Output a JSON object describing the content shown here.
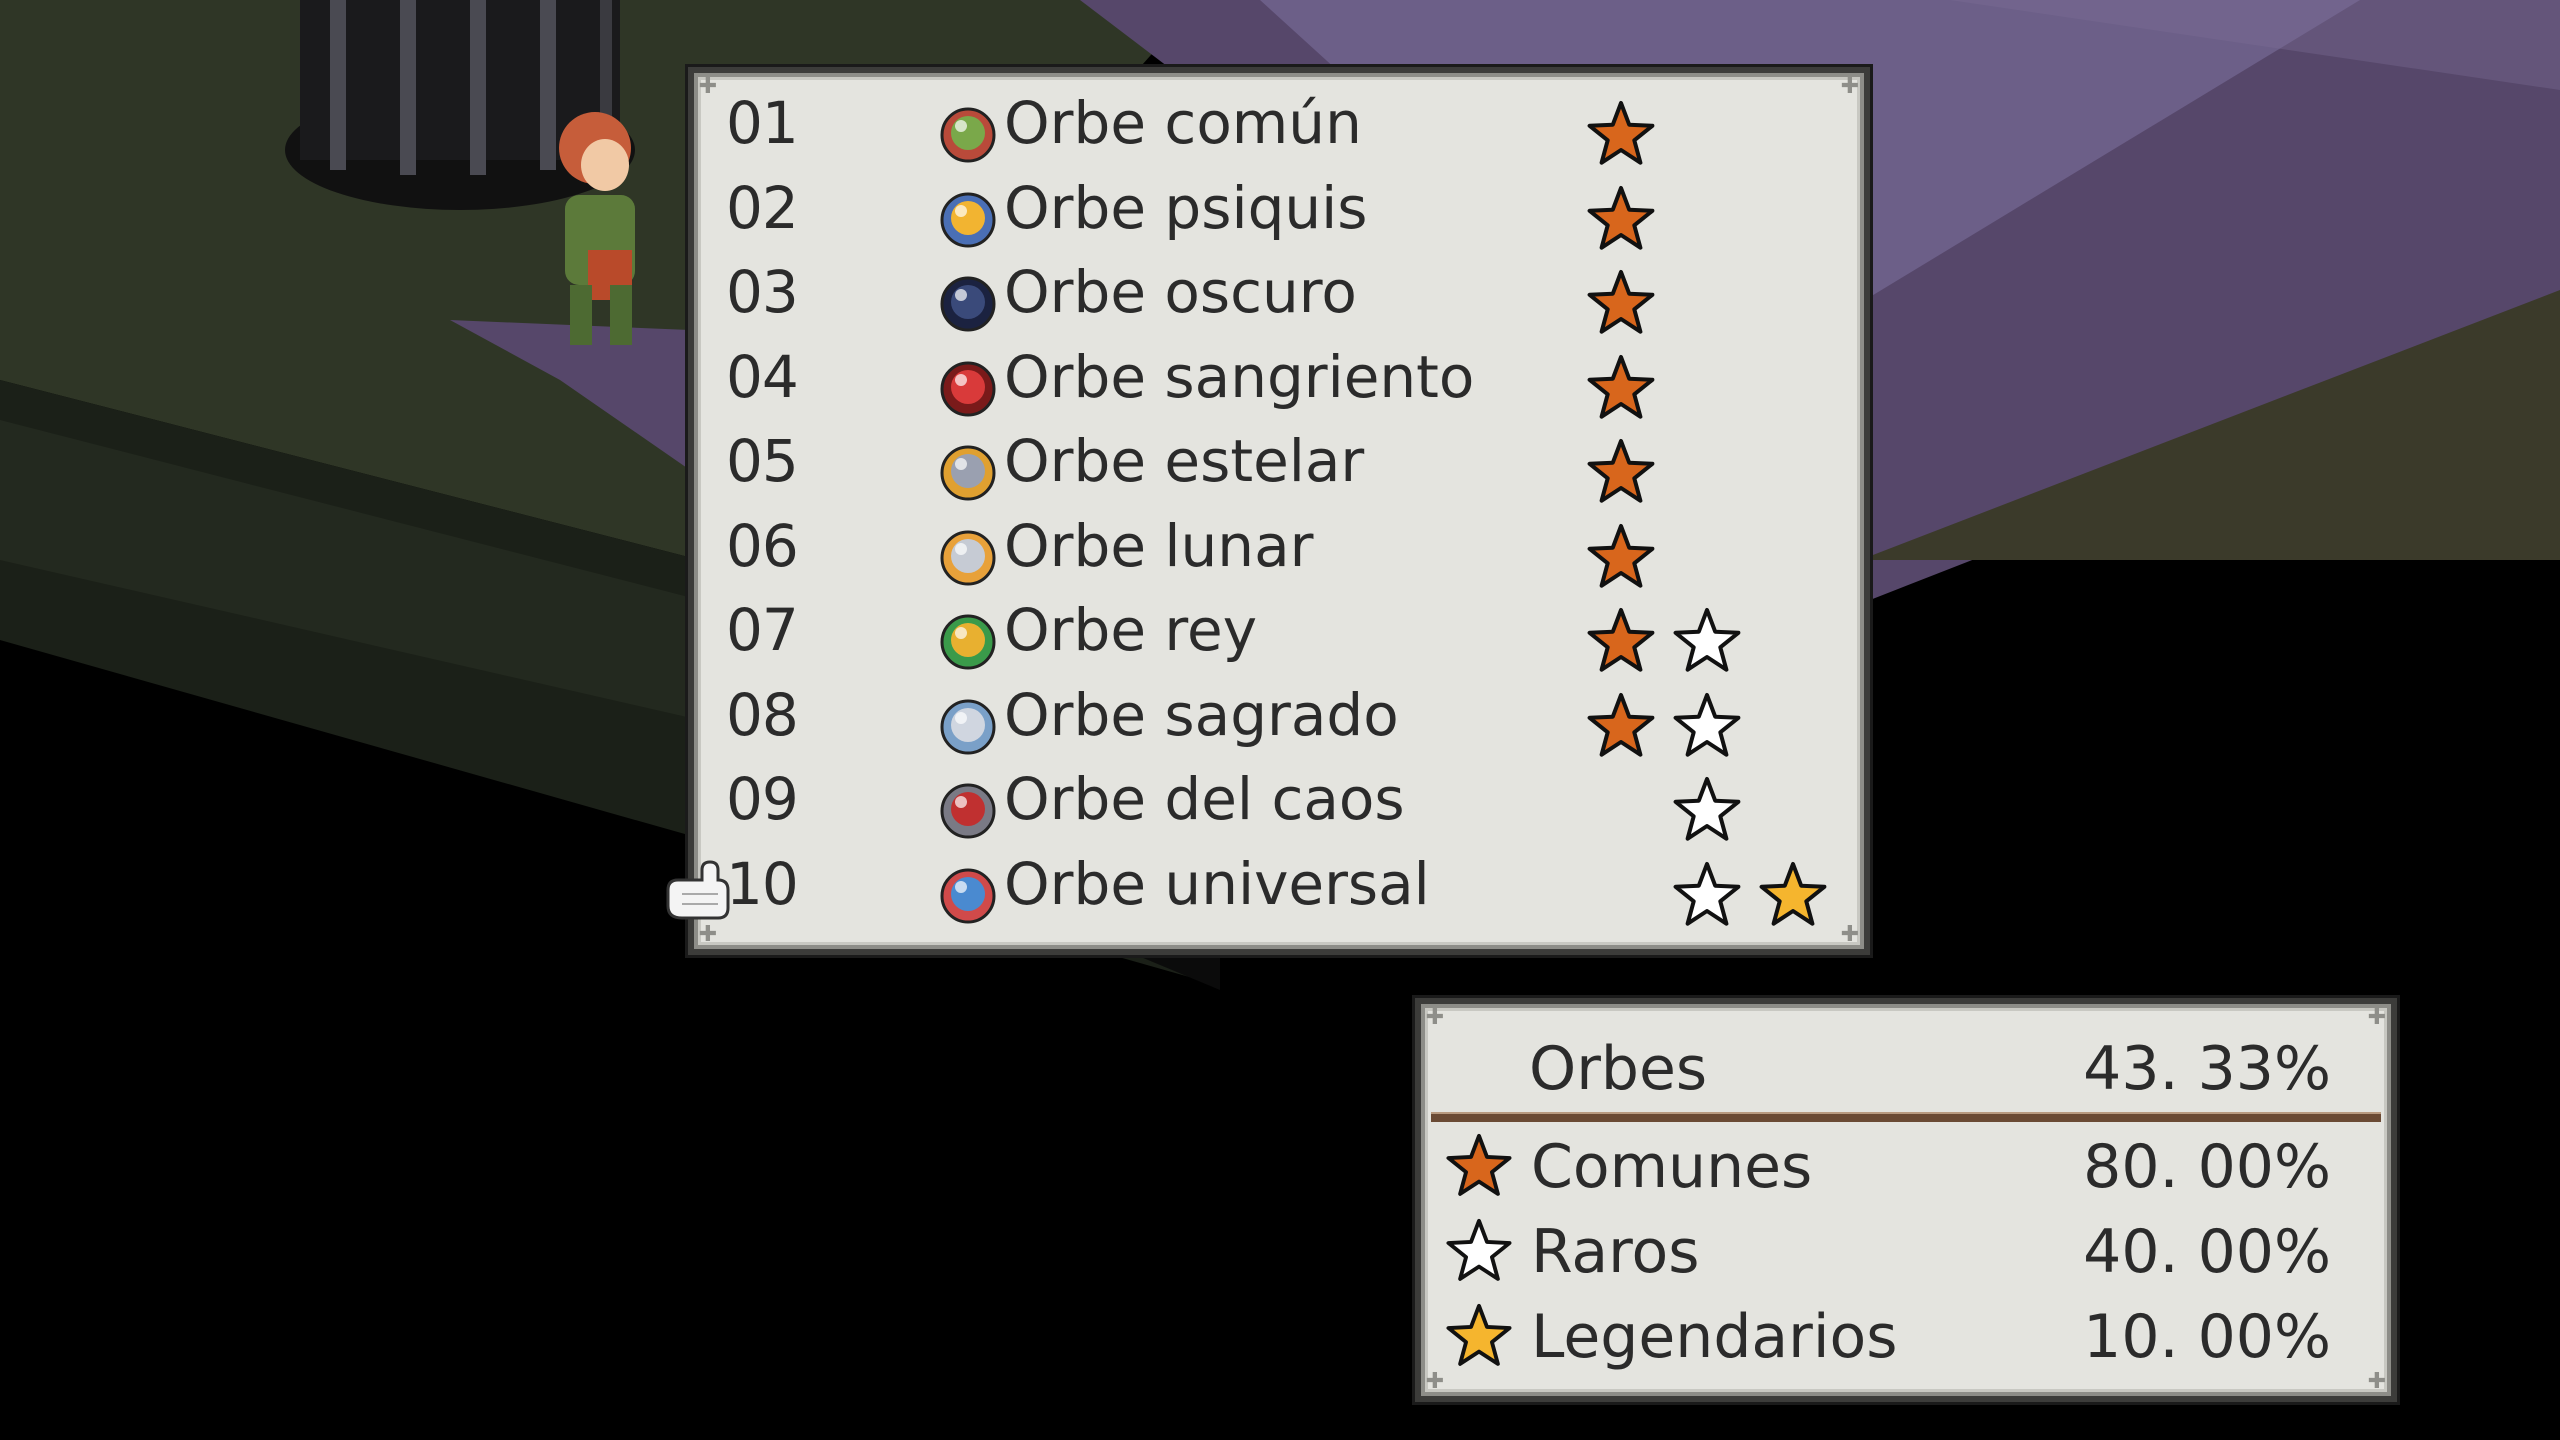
{
  "orb_list": {
    "items": [
      {
        "num": "01",
        "name": "Orbe común",
        "icon": "green-orb-icon",
        "stars": [
          "common"
        ]
      },
      {
        "num": "02",
        "name": "Orbe psiquis",
        "icon": "gold-orb-icon",
        "stars": [
          "common"
        ]
      },
      {
        "num": "03",
        "name": "Orbe oscuro",
        "icon": "dark-orb-icon",
        "stars": [
          "common"
        ]
      },
      {
        "num": "04",
        "name": "Orbe sangriento",
        "icon": "red-orb-icon",
        "stars": [
          "common"
        ]
      },
      {
        "num": "05",
        "name": "Orbe estelar",
        "icon": "star-orb-icon",
        "stars": [
          "common"
        ]
      },
      {
        "num": "06",
        "name": "Orbe lunar",
        "icon": "moon-orb-icon",
        "stars": [
          "common"
        ]
      },
      {
        "num": "07",
        "name": "Orbe rey",
        "icon": "king-orb-icon",
        "stars": [
          "common",
          "rare"
        ]
      },
      {
        "num": "08",
        "name": "Orbe sagrado",
        "icon": "holy-orb-icon",
        "stars": [
          "common",
          "rare"
        ]
      },
      {
        "num": "09",
        "name": "Orbe del caos",
        "icon": "chaos-orb-icon",
        "stars": [
          null,
          "rare"
        ]
      },
      {
        "num": "10",
        "name": "Orbe universal",
        "icon": "universal-orb-icon",
        "stars": [
          null,
          "rare",
          "legendary"
        ]
      }
    ],
    "selected_index": 9
  },
  "summary": {
    "title": "Orbes",
    "total": "43. 33%",
    "rows": [
      {
        "type": "common",
        "label": "Comunes",
        "pct": "80. 00%"
      },
      {
        "type": "rare",
        "label": "Raros",
        "pct": "40. 00%"
      },
      {
        "type": "legendary",
        "label": "Legendarios",
        "pct": "10. 00%"
      }
    ]
  },
  "colors": {
    "common_star": "#d8661c",
    "rare_star": "#ffffff",
    "legendary_star": "#f5b52e",
    "panel_bg": "#e4e4df",
    "text": "#2b2b2b"
  }
}
